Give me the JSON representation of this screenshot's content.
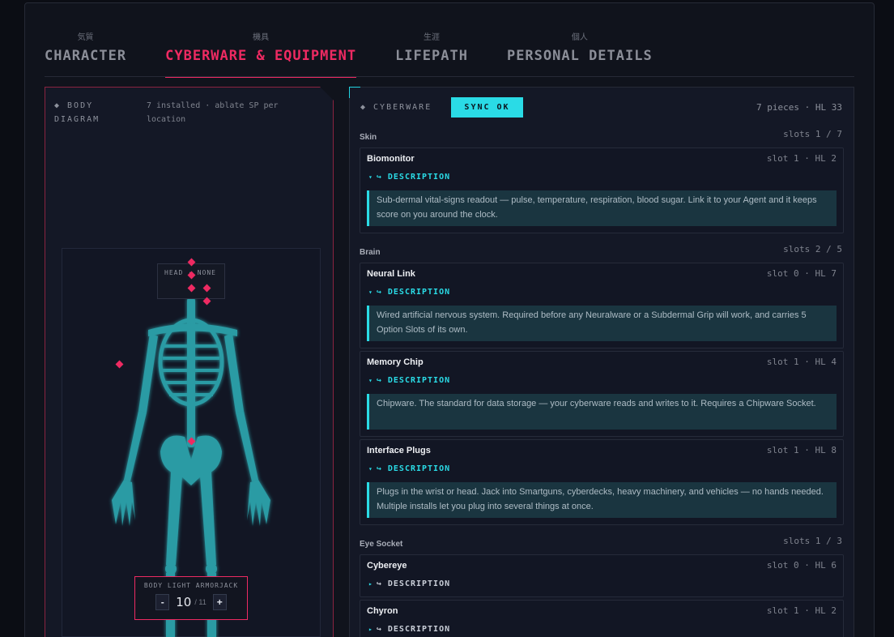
{
  "tabs": [
    {
      "kanji": "気質",
      "label": "CHARACTER",
      "active": false
    },
    {
      "kanji": "機具",
      "label": "CYBERWARE & EQUIPMENT",
      "active": true
    },
    {
      "kanji": "生涯",
      "label": "LIFEPATH",
      "active": false
    },
    {
      "kanji": "個人",
      "label": "PERSONAL DETAILS",
      "active": false
    }
  ],
  "body_diagram": {
    "title": "◆ BODY DIAGRAM",
    "subtitle": "7 installed · ablate SP per location",
    "head_label": "HEAD · NONE",
    "armor": {
      "label": "BODY LIGHT ARMORJACK",
      "value": "10",
      "max": "11",
      "minus": "-",
      "plus": "+"
    }
  },
  "cyberware": {
    "title": "◆ CYBERWARE",
    "sync": "SYNC OK",
    "meta": "7 pieces · HL 33",
    "desc_label": "DESCRIPTION",
    "groups": [
      {
        "name": "Skin",
        "slots": "slots 1 / 7"
      },
      {
        "name": "Brain",
        "slots": "slots 2 / 5"
      },
      {
        "name": "Eye Socket",
        "slots": "slots 1 / 3"
      }
    ],
    "items": [
      {
        "name": "Biomonitor",
        "meta": "slot 1 · HL 2",
        "desc": "Sub-dermal vital-signs readout — pulse, temperature, respiration, blood sugar. Link it to your Agent and it keeps score on you around the clock."
      },
      {
        "name": "Neural Link",
        "meta": "slot 0 · HL 7",
        "desc": "Wired artificial nervous system. Required before any Neuralware or a Subdermal Grip will work, and carries 5 Option Slots of its own."
      },
      {
        "name": "Memory Chip",
        "meta": "slot 1 · HL 4",
        "desc": "Chipware. The standard for data storage — your cyberware reads and writes to it. Requires a Chipware Socket."
      },
      {
        "name": "Interface Plugs",
        "meta": "slot 1 · HL 8",
        "desc": "Plugs in the wrist or head. Jack into Smartguns, cyberdecks, heavy machinery, and vehicles — no hands needed. Multiple installs let you plug into several things at once."
      },
      {
        "name": "Cybereye",
        "meta": "slot 0 · HL 6"
      },
      {
        "name": "Chyron",
        "meta": "slot 1 · HL 2"
      }
    ]
  },
  "colors": {
    "accent": "#ee2a62",
    "cyan": "#2adbe6",
    "bone": "#2a9ba4"
  }
}
